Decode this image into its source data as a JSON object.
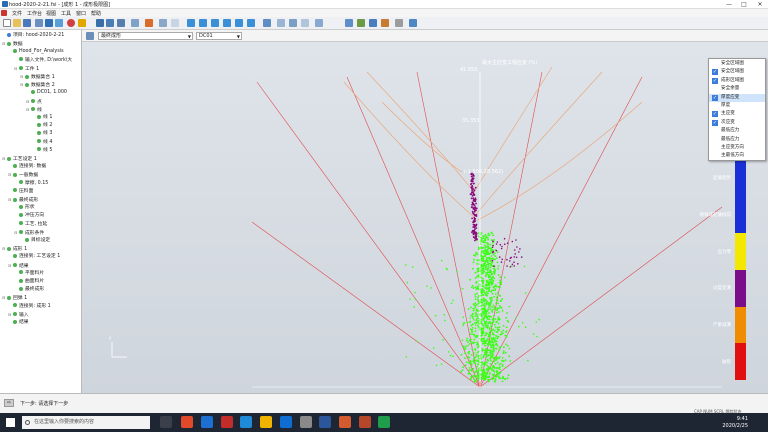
{
  "window": {
    "title": "hood-2020-2-21.fsi - [成形 1 - 成形极限图]",
    "controls": [
      "—",
      "□",
      "✕"
    ]
  },
  "menu": [
    "文件",
    "工作台",
    "视图",
    "工具",
    "窗口",
    "帮助"
  ],
  "toolbar2": {
    "view_dropdown": "最终成形",
    "step_dropdown": "DC01"
  },
  "tree": [
    {
      "label": "项目: hood-2020-2-21",
      "level": 0,
      "type": "root"
    },
    {
      "label": "数据",
      "level": 0,
      "type": "folder"
    },
    {
      "label": "Hood_For_Analysis",
      "level": 1,
      "type": "item"
    },
    {
      "label": "输入文件, D:\\work\\大",
      "level": 2,
      "type": "item"
    },
    {
      "label": "工件 1",
      "level": 2,
      "type": "folder"
    },
    {
      "label": "数据集合 1",
      "level": 3,
      "type": "folder"
    },
    {
      "label": "数据集合 2",
      "level": 3,
      "type": "folder"
    },
    {
      "label": "DC01, 1.000",
      "level": 4,
      "type": "item"
    },
    {
      "label": "点",
      "level": 4,
      "type": "folder"
    },
    {
      "label": "线",
      "level": 4,
      "type": "folder"
    },
    {
      "label": "线 1",
      "level": 5,
      "type": "item"
    },
    {
      "label": "线 2",
      "level": 5,
      "type": "item"
    },
    {
      "label": "线 3",
      "level": 5,
      "type": "item"
    },
    {
      "label": "线 4",
      "level": 5,
      "type": "item"
    },
    {
      "label": "线 5",
      "level": 5,
      "type": "item"
    },
    {
      "label": "工艺设定 1",
      "level": 0,
      "type": "folder"
    },
    {
      "label": "连接到: 数据",
      "level": 1,
      "type": "item"
    },
    {
      "label": "一般数据",
      "level": 1,
      "type": "folder"
    },
    {
      "label": "摩擦, 0.15",
      "level": 2,
      "type": "item"
    },
    {
      "label": "压料面",
      "level": 1,
      "type": "item"
    },
    {
      "label": "最终成形",
      "level": 1,
      "type": "folder"
    },
    {
      "label": "形状",
      "level": 2,
      "type": "item"
    },
    {
      "label": "冲压方向",
      "level": 2,
      "type": "item"
    },
    {
      "label": "工艺, 拉延",
      "level": 2,
      "type": "item"
    },
    {
      "label": "成形条件",
      "level": 2,
      "type": "folder"
    },
    {
      "label": "目标设定",
      "level": 3,
      "type": "item"
    },
    {
      "label": "成形 1",
      "level": 0,
      "type": "folder"
    },
    {
      "label": "连接到: 工艺设定 1",
      "level": 1,
      "type": "item"
    },
    {
      "label": "结果",
      "level": 1,
      "type": "folder"
    },
    {
      "label": "平面料片",
      "level": 2,
      "type": "item"
    },
    {
      "label": "曲面料片",
      "level": 2,
      "type": "item"
    },
    {
      "label": "最终成形",
      "level": 2,
      "type": "item"
    },
    {
      "label": "回弹 1",
      "level": 0,
      "type": "folder"
    },
    {
      "label": "连接到: 成形 1",
      "level": 1,
      "type": "item"
    },
    {
      "label": "输入",
      "level": 1,
      "type": "folder"
    },
    {
      "label": "结果",
      "level": 1,
      "type": "item"
    }
  ],
  "chart": {
    "title": "最大主应变工程应变 (%)",
    "tick_labels": [
      "41.655",
      "35.353"
    ],
    "point_label": "(-1.508,28.562)",
    "axis_label": "y"
  },
  "context_menu": [
    {
      "label": "安全区域图",
      "checked": false
    },
    {
      "label": "安全区域图",
      "checked": true
    },
    {
      "label": "成形区域图",
      "checked": true
    },
    {
      "label": "安全余量",
      "checked": false
    },
    {
      "label": "厚度应变",
      "checked": true,
      "highlight": true
    },
    {
      "label": "厚度",
      "checked": false
    },
    {
      "label": "主应变",
      "checked": true
    },
    {
      "label": "次应变",
      "checked": true
    },
    {
      "label": "最低应力",
      "checked": false
    },
    {
      "label": "最低应力",
      "checked": false
    },
    {
      "label": "主应变方向",
      "checked": false
    },
    {
      "label": "主最低方向",
      "checked": false
    }
  ],
  "legend": [
    {
      "label": "起皱趋势",
      "color": "#1b2fd6"
    },
    {
      "label": "褶皱或起皱倾向",
      "color": "#1b2fd6"
    },
    {
      "label": "应力零",
      "color": "#f5e800"
    },
    {
      "label": "过度变薄",
      "color": "#7a0e8a"
    },
    {
      "label": "严重减薄",
      "color": "#f08c00"
    },
    {
      "label": "破裂",
      "color": "#e01010"
    }
  ],
  "status": {
    "prompt": "下一步: 请选择下一步",
    "indicators": "CAP NUM SCRL 跟踪状态"
  },
  "taskbar": {
    "search_placeholder": "在这里输入你要搜索的内容",
    "time": "9:41",
    "date": "2020/2/25"
  },
  "colors": {
    "accent": "#3b7dd8",
    "safe_points": "#39ff14",
    "wrinkle_points": "#8a0a7a",
    "limit_lines": "#e04a4a",
    "forming_curves": "#e8a87c"
  }
}
